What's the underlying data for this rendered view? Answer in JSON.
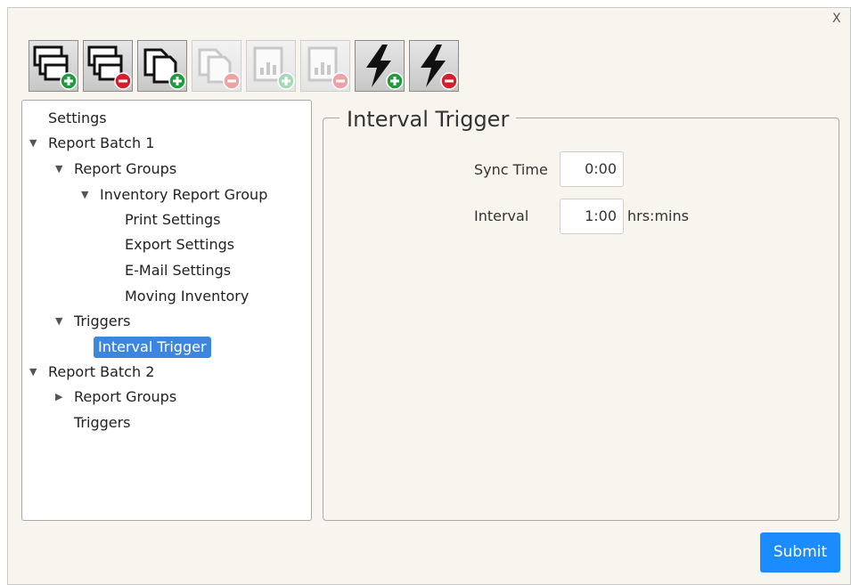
{
  "dialog": {
    "close_label": "X"
  },
  "toolbar": {
    "buttons": [
      {
        "name": "add-report-batch-button",
        "icon": "stacked-windows-add-icon",
        "enabled": true
      },
      {
        "name": "remove-report-batch-button",
        "icon": "stacked-windows-remove-icon",
        "enabled": true
      },
      {
        "name": "add-report-group-button",
        "icon": "copy-pages-add-icon",
        "enabled": true
      },
      {
        "name": "remove-report-group-button",
        "icon": "copy-pages-remove-icon",
        "enabled": false
      },
      {
        "name": "add-report-button",
        "icon": "report-chart-add-icon",
        "enabled": false
      },
      {
        "name": "remove-report-button",
        "icon": "report-chart-remove-icon",
        "enabled": false
      },
      {
        "name": "add-trigger-button",
        "icon": "lightning-add-icon",
        "enabled": true
      },
      {
        "name": "remove-trigger-button",
        "icon": "lightning-remove-icon",
        "enabled": true
      }
    ]
  },
  "tree": {
    "settings": "Settings",
    "batch1": "Report Batch 1",
    "batch1_groups": "Report Groups",
    "inventory_group": "Inventory Report Group",
    "print_settings": "Print Settings",
    "export_settings": "Export Settings",
    "email_settings": "E-Mail Settings",
    "moving_inventory": "Moving Inventory",
    "batch1_triggers": "Triggers",
    "interval_trigger": "Interval Trigger",
    "batch2": "Report Batch 2",
    "batch2_groups": "Report Groups",
    "batch2_triggers": "Triggers"
  },
  "panel": {
    "title": "Interval Trigger",
    "sync_time_label": "Sync Time",
    "sync_time_value": "0:00",
    "interval_label": "Interval",
    "interval_value": "1:00",
    "interval_unit": "hrs:mins"
  },
  "footer": {
    "submit_label": "Submit"
  },
  "colors": {
    "accent": "#1a8cff",
    "selection": "#3d86e0",
    "add": "#1f9a3c",
    "remove": "#d21f2e"
  }
}
